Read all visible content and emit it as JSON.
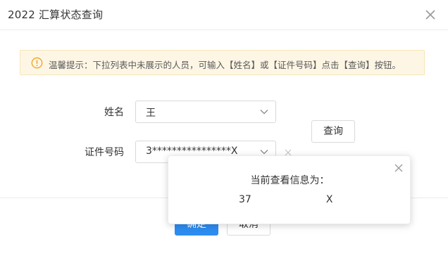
{
  "dialog": {
    "title": "2022 汇算状态查询"
  },
  "alert": {
    "text": "温馨提示：下拉列表中未展示的人员，可输入【姓名】或【证件号码】点击【查询】按钮。"
  },
  "form": {
    "name_label": "姓名",
    "name_value": "王",
    "id_label": "证件号码",
    "id_value": "3****************X",
    "query_button": "查询"
  },
  "footer": {
    "ok_button": "确定",
    "cancel_button": "取消"
  },
  "popover": {
    "title": "当前查看信息为：",
    "id_prefix": "37",
    "id_suffix": "X"
  },
  "colors": {
    "primary": "#2d8cf0",
    "alert_bg": "#fdf6e4",
    "alert_icon": "#f0a020"
  }
}
